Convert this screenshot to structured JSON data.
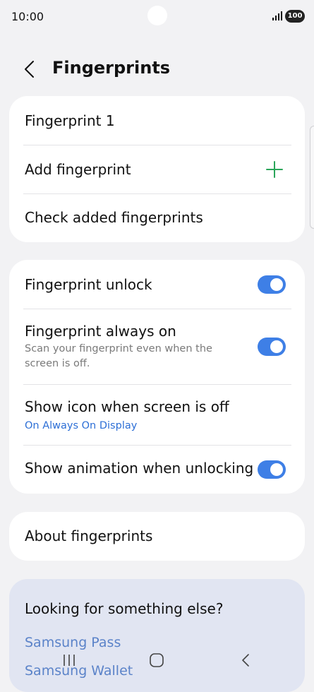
{
  "status": {
    "time": "10:00",
    "battery": "100"
  },
  "header": {
    "title": "Fingerprints"
  },
  "registered": {
    "fingerprint_1": "Fingerprint 1",
    "add_fingerprint": "Add fingerprint",
    "check_added": "Check added fingerprints"
  },
  "settings": {
    "unlock": {
      "label": "Fingerprint unlock",
      "enabled": true
    },
    "always_on": {
      "label": "Fingerprint always on",
      "sub": "Scan your fingerprint even when the screen is off.",
      "enabled": true
    },
    "show_icon": {
      "label": "Show icon when screen is off",
      "sub": "On Always On Display"
    },
    "animation": {
      "label": "Show animation when unlocking",
      "enabled": true
    }
  },
  "about": {
    "label": "About fingerprints"
  },
  "suggestions": {
    "title": "Looking for something else?",
    "links": [
      "Samsung Pass",
      "Samsung Wallet"
    ]
  },
  "colors": {
    "accent": "#3e7fe6",
    "plus": "#2aa55a",
    "link": "#2d6fd6"
  }
}
